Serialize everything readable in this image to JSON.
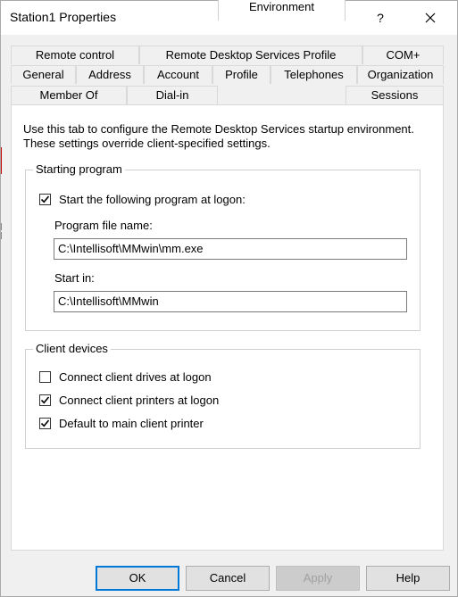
{
  "window": {
    "title": "Station1 Properties",
    "help_glyph": "?"
  },
  "tabs": {
    "row1": [
      "Remote control",
      "Remote Desktop Services Profile",
      "COM+"
    ],
    "row2": [
      "General",
      "Address",
      "Account",
      "Profile",
      "Telephones",
      "Organization"
    ],
    "row3": [
      "Member Of",
      "Dial-in",
      "Environment",
      "Sessions"
    ],
    "selected": "Environment"
  },
  "panel": {
    "intro_line1": "Use this tab to configure the Remote Desktop Services startup environment.",
    "intro_line2": "These settings override client-specified settings.",
    "starting_program": {
      "title": "Starting program",
      "start_program_label": "Start the following program at logon:",
      "start_program_checked": true,
      "program_file_label": "Program file name:",
      "program_file_value": "C:\\Intellisoft\\MMwin\\mm.exe",
      "start_in_label": "Start in:",
      "start_in_value": "C:\\Intellisoft\\MMwin"
    },
    "client_devices": {
      "title": "Client devices",
      "items": [
        {
          "label": "Connect client drives at logon",
          "checked": false
        },
        {
          "label": "Connect client printers at logon",
          "checked": true
        },
        {
          "label": "Default to main client printer",
          "checked": true
        }
      ]
    }
  },
  "buttons": {
    "ok": "OK",
    "cancel": "Cancel",
    "apply": "Apply",
    "help": "Help"
  }
}
